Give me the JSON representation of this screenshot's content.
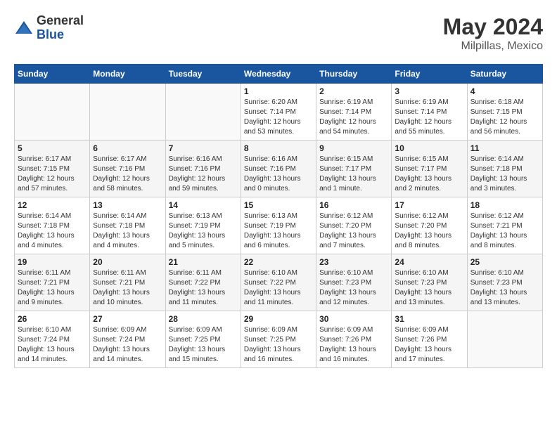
{
  "header": {
    "logo_general": "General",
    "logo_blue": "Blue",
    "title": "May 2024",
    "location": "Milpillas, Mexico"
  },
  "calendar": {
    "weekdays": [
      "Sunday",
      "Monday",
      "Tuesday",
      "Wednesday",
      "Thursday",
      "Friday",
      "Saturday"
    ],
    "weeks": [
      [
        {
          "day": "",
          "info": ""
        },
        {
          "day": "",
          "info": ""
        },
        {
          "day": "",
          "info": ""
        },
        {
          "day": "1",
          "info": "Sunrise: 6:20 AM\nSunset: 7:14 PM\nDaylight: 12 hours\nand 53 minutes."
        },
        {
          "day": "2",
          "info": "Sunrise: 6:19 AM\nSunset: 7:14 PM\nDaylight: 12 hours\nand 54 minutes."
        },
        {
          "day": "3",
          "info": "Sunrise: 6:19 AM\nSunset: 7:14 PM\nDaylight: 12 hours\nand 55 minutes."
        },
        {
          "day": "4",
          "info": "Sunrise: 6:18 AM\nSunset: 7:15 PM\nDaylight: 12 hours\nand 56 minutes."
        }
      ],
      [
        {
          "day": "5",
          "info": "Sunrise: 6:17 AM\nSunset: 7:15 PM\nDaylight: 12 hours\nand 57 minutes."
        },
        {
          "day": "6",
          "info": "Sunrise: 6:17 AM\nSunset: 7:16 PM\nDaylight: 12 hours\nand 58 minutes."
        },
        {
          "day": "7",
          "info": "Sunrise: 6:16 AM\nSunset: 7:16 PM\nDaylight: 12 hours\nand 59 minutes."
        },
        {
          "day": "8",
          "info": "Sunrise: 6:16 AM\nSunset: 7:16 PM\nDaylight: 13 hours\nand 0 minutes."
        },
        {
          "day": "9",
          "info": "Sunrise: 6:15 AM\nSunset: 7:17 PM\nDaylight: 13 hours\nand 1 minute."
        },
        {
          "day": "10",
          "info": "Sunrise: 6:15 AM\nSunset: 7:17 PM\nDaylight: 13 hours\nand 2 minutes."
        },
        {
          "day": "11",
          "info": "Sunrise: 6:14 AM\nSunset: 7:18 PM\nDaylight: 13 hours\nand 3 minutes."
        }
      ],
      [
        {
          "day": "12",
          "info": "Sunrise: 6:14 AM\nSunset: 7:18 PM\nDaylight: 13 hours\nand 4 minutes."
        },
        {
          "day": "13",
          "info": "Sunrise: 6:14 AM\nSunset: 7:18 PM\nDaylight: 13 hours\nand 4 minutes."
        },
        {
          "day": "14",
          "info": "Sunrise: 6:13 AM\nSunset: 7:19 PM\nDaylight: 13 hours\nand 5 minutes."
        },
        {
          "day": "15",
          "info": "Sunrise: 6:13 AM\nSunset: 7:19 PM\nDaylight: 13 hours\nand 6 minutes."
        },
        {
          "day": "16",
          "info": "Sunrise: 6:12 AM\nSunset: 7:20 PM\nDaylight: 13 hours\nand 7 minutes."
        },
        {
          "day": "17",
          "info": "Sunrise: 6:12 AM\nSunset: 7:20 PM\nDaylight: 13 hours\nand 8 minutes."
        },
        {
          "day": "18",
          "info": "Sunrise: 6:12 AM\nSunset: 7:21 PM\nDaylight: 13 hours\nand 8 minutes."
        }
      ],
      [
        {
          "day": "19",
          "info": "Sunrise: 6:11 AM\nSunset: 7:21 PM\nDaylight: 13 hours\nand 9 minutes."
        },
        {
          "day": "20",
          "info": "Sunrise: 6:11 AM\nSunset: 7:21 PM\nDaylight: 13 hours\nand 10 minutes."
        },
        {
          "day": "21",
          "info": "Sunrise: 6:11 AM\nSunset: 7:22 PM\nDaylight: 13 hours\nand 11 minutes."
        },
        {
          "day": "22",
          "info": "Sunrise: 6:10 AM\nSunset: 7:22 PM\nDaylight: 13 hours\nand 11 minutes."
        },
        {
          "day": "23",
          "info": "Sunrise: 6:10 AM\nSunset: 7:23 PM\nDaylight: 13 hours\nand 12 minutes."
        },
        {
          "day": "24",
          "info": "Sunrise: 6:10 AM\nSunset: 7:23 PM\nDaylight: 13 hours\nand 13 minutes."
        },
        {
          "day": "25",
          "info": "Sunrise: 6:10 AM\nSunset: 7:23 PM\nDaylight: 13 hours\nand 13 minutes."
        }
      ],
      [
        {
          "day": "26",
          "info": "Sunrise: 6:10 AM\nSunset: 7:24 PM\nDaylight: 13 hours\nand 14 minutes."
        },
        {
          "day": "27",
          "info": "Sunrise: 6:09 AM\nSunset: 7:24 PM\nDaylight: 13 hours\nand 14 minutes."
        },
        {
          "day": "28",
          "info": "Sunrise: 6:09 AM\nSunset: 7:25 PM\nDaylight: 13 hours\nand 15 minutes."
        },
        {
          "day": "29",
          "info": "Sunrise: 6:09 AM\nSunset: 7:25 PM\nDaylight: 13 hours\nand 16 minutes."
        },
        {
          "day": "30",
          "info": "Sunrise: 6:09 AM\nSunset: 7:26 PM\nDaylight: 13 hours\nand 16 minutes."
        },
        {
          "day": "31",
          "info": "Sunrise: 6:09 AM\nSunset: 7:26 PM\nDaylight: 13 hours\nand 17 minutes."
        },
        {
          "day": "",
          "info": ""
        }
      ]
    ]
  }
}
